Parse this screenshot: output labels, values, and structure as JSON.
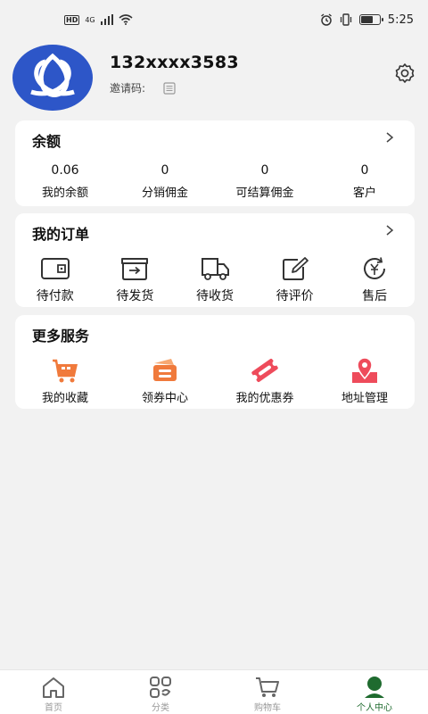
{
  "status_bar": {
    "network": "4G",
    "hd": "HD",
    "time": "5:25"
  },
  "profile": {
    "phone": "132xxxx3583",
    "invite_label": "邀请码:"
  },
  "balance": {
    "title": "余额",
    "stats": [
      {
        "value": "0.06",
        "label": "我的余额"
      },
      {
        "value": "0",
        "label": "分销佣金"
      },
      {
        "value": "0",
        "label": "可结算佣金"
      },
      {
        "value": "0",
        "label": "客户"
      }
    ]
  },
  "orders": {
    "title": "我的订单",
    "items": [
      {
        "label": "待付款",
        "icon": "wallet-icon"
      },
      {
        "label": "待发货",
        "icon": "box-arrow-icon"
      },
      {
        "label": "待收货",
        "icon": "truck-icon"
      },
      {
        "label": "待评价",
        "icon": "edit-icon"
      },
      {
        "label": "售后",
        "icon": "refund-icon"
      }
    ]
  },
  "services": {
    "title": "更多服务",
    "items": [
      {
        "label": "我的收藏",
        "icon": "cart-icon"
      },
      {
        "label": "领券中心",
        "icon": "coupon-center-icon"
      },
      {
        "label": "我的优惠券",
        "icon": "ticket-icon"
      },
      {
        "label": "地址管理",
        "icon": "location-icon"
      }
    ]
  },
  "tabbar": {
    "items": [
      {
        "label": "首页",
        "icon": "home-icon"
      },
      {
        "label": "分类",
        "icon": "category-icon"
      },
      {
        "label": "购物车",
        "icon": "cart-tab-icon"
      },
      {
        "label": "个人中心",
        "icon": "person-icon"
      }
    ],
    "active_color": "#1f6b2f"
  },
  "colors": {
    "avatar_bg": "#2d56c8",
    "service_orange": "#f07a3c",
    "service_red": "#ee4b5b"
  }
}
